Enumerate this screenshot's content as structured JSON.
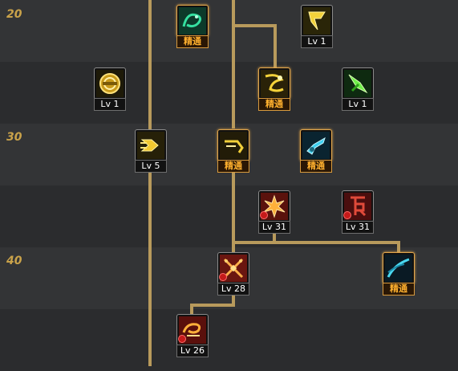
{
  "levels": [
    "20",
    "30",
    "40"
  ],
  "skills": [
    {
      "id": "s1",
      "label": "精通",
      "icon": "green-dragon-icon",
      "mastery": true
    },
    {
      "id": "s2",
      "label": "Lv 1",
      "icon": "yellow-shield-icon",
      "mastery": false
    },
    {
      "id": "s3",
      "label": "Lv 1",
      "icon": "gold-orb-icon",
      "mastery": false
    },
    {
      "id": "s4",
      "label": "精通",
      "icon": "yellow-whirl-icon",
      "mastery": true
    },
    {
      "id": "s5",
      "label": "Lv 1",
      "icon": "green-blade-icon",
      "mastery": false
    },
    {
      "id": "s6",
      "label": "Lv 5",
      "icon": "yellow-dash-icon",
      "mastery": false
    },
    {
      "id": "s7",
      "label": "精通",
      "icon": "yellow-hook-icon",
      "mastery": true
    },
    {
      "id": "s8",
      "label": "精通",
      "icon": "cyan-gun-icon",
      "mastery": true
    },
    {
      "id": "s9",
      "label": "Lv 31",
      "icon": "red-burst-icon",
      "mastery": false
    },
    {
      "id": "s10",
      "label": "Lv 31",
      "icon": "red-rune-icon",
      "mastery": false
    },
    {
      "id": "s11",
      "label": "Lv 28",
      "icon": "red-cross-icon",
      "mastery": false
    },
    {
      "id": "s12",
      "label": "精通",
      "icon": "cyan-wave-icon",
      "mastery": true
    },
    {
      "id": "s13",
      "label": "Lv 26",
      "icon": "red-swirl-icon",
      "mastery": false
    }
  ]
}
